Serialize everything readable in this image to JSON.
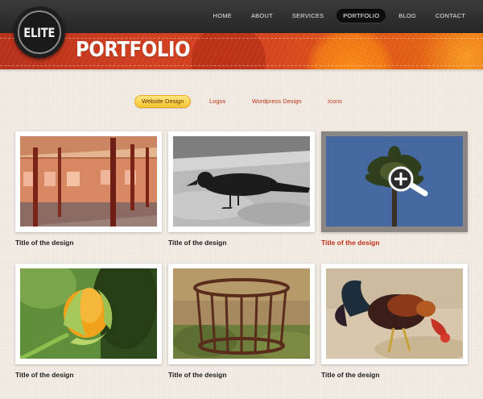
{
  "logo": {
    "text": "ELITE"
  },
  "nav": {
    "items": [
      {
        "label": "HOME",
        "active": false
      },
      {
        "label": "ABOUT",
        "active": false
      },
      {
        "label": "SERVICES",
        "active": false
      },
      {
        "label": "PORTFOLIO",
        "active": true
      },
      {
        "label": "BLOG",
        "active": false
      },
      {
        "label": "CONTACT",
        "active": false
      }
    ]
  },
  "page": {
    "title": "PORTFOLIO"
  },
  "filters": {
    "items": [
      {
        "label": "Website Design",
        "active": true
      },
      {
        "label": "Logos",
        "active": false
      },
      {
        "label": "Wordpress Design",
        "active": false
      },
      {
        "label": "Icons",
        "active": false
      }
    ]
  },
  "portfolio": {
    "items": [
      {
        "title": "Title of the design",
        "image": "arcade-building-photo",
        "hover": false
      },
      {
        "title": "Title of the design",
        "image": "crow-photo",
        "hover": false
      },
      {
        "title": "Title of the design",
        "image": "palm-tree-photo",
        "hover": true
      },
      {
        "title": "Title of the design",
        "image": "orange-flower-bud-photo",
        "hover": false
      },
      {
        "title": "Title of the design",
        "image": "rusty-basket-photo",
        "hover": false
      },
      {
        "title": "Title of the design",
        "image": "rooster-photo",
        "hover": false
      }
    ]
  },
  "colors": {
    "accent": "#c2331a",
    "banner": "#d6451f",
    "nav_bg": "#2e2e2e",
    "filter_active": "#f7c431",
    "page_bg": "#f3ede4"
  },
  "icons": {
    "zoom": "magnifier-plus-icon"
  }
}
